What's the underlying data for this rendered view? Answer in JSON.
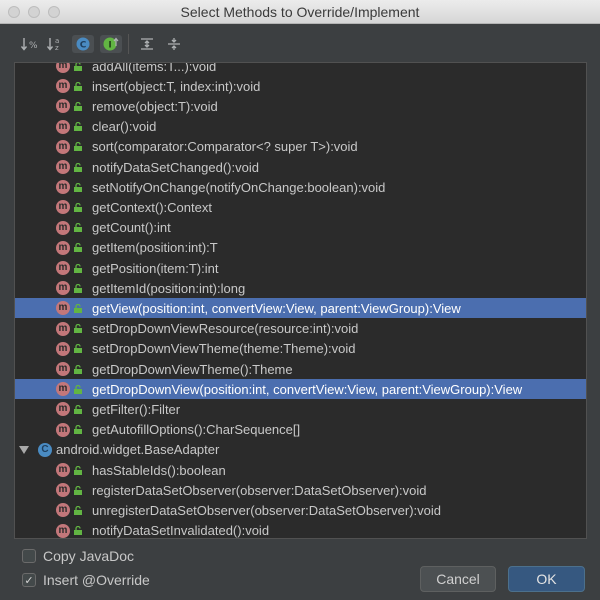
{
  "window": {
    "title": "Select Methods to Override/Implement"
  },
  "toolbar": {
    "sort_visibility_label": "↓%",
    "sort_alpha_label": "↓ᵃz",
    "class_toggle_label": "C",
    "interface_toggle_label": "I"
  },
  "rows": [
    {
      "label": "addAll(items:T...):void"
    },
    {
      "label": "insert(object:T, index:int):void"
    },
    {
      "label": "remove(object:T):void"
    },
    {
      "label": "clear():void"
    },
    {
      "label": "sort(comparator:Comparator<? super T>):void"
    },
    {
      "label": "notifyDataSetChanged():void"
    },
    {
      "label": "setNotifyOnChange(notifyOnChange:boolean):void"
    },
    {
      "label": "getContext():Context"
    },
    {
      "label": "getCount():int"
    },
    {
      "label": "getItem(position:int):T"
    },
    {
      "label": "getPosition(item:T):int"
    },
    {
      "label": "getItemId(position:int):long"
    },
    {
      "label": "getView(position:int, convertView:View, parent:ViewGroup):View",
      "selected": true
    },
    {
      "label": "setDropDownViewResource(resource:int):void"
    },
    {
      "label": "setDropDownViewTheme(theme:Theme):void"
    },
    {
      "label": "getDropDownViewTheme():Theme"
    },
    {
      "label": "getDropDownView(position:int, convertView:View, parent:ViewGroup):View",
      "selected": true
    },
    {
      "label": "getFilter():Filter"
    },
    {
      "label": "getAutofillOptions():CharSequence[]"
    },
    {
      "label": "android.widget.BaseAdapter",
      "group": true
    },
    {
      "label": "hasStableIds():boolean"
    },
    {
      "label": "registerDataSetObserver(observer:DataSetObserver):void"
    },
    {
      "label": "unregisterDataSetObserver(observer:DataSetObserver):void"
    },
    {
      "label": "notifyDataSetInvalidated():void"
    }
  ],
  "icons": {
    "method_letter": "m",
    "class_letter": "C"
  },
  "options": {
    "copy_javadoc": {
      "label": "Copy JavaDoc",
      "checked": false
    },
    "insert_override": {
      "label": "Insert @Override",
      "checked": true,
      "mark": "✓"
    }
  },
  "buttons": {
    "cancel": "Cancel",
    "ok": "OK"
  },
  "colors": {
    "selection": "#4b6eaf",
    "method_icon": "#c3777a",
    "class_icon": "#4a8bc2",
    "lock_icon": "#62b543"
  }
}
